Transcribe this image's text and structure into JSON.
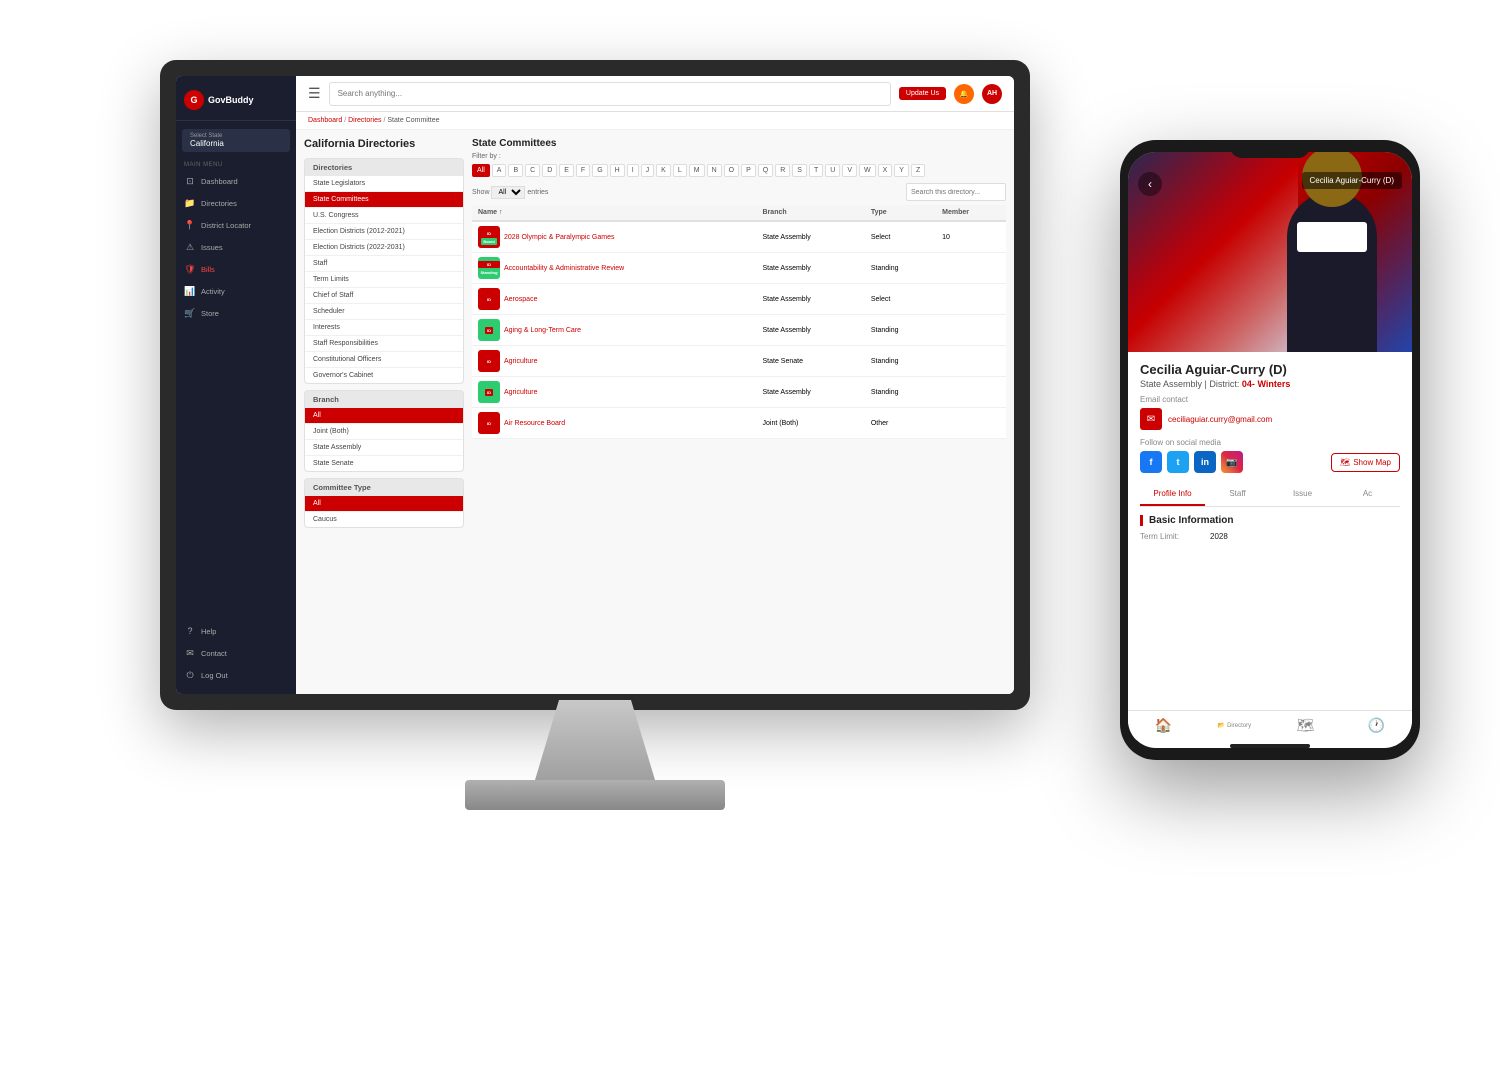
{
  "page": {
    "background": "#f0f0f0"
  },
  "app": {
    "name": "GovBuddy",
    "logo_letter": "G"
  },
  "header": {
    "search_placeholder": "Search anything...",
    "update_btn": "Update Us",
    "menu_icon": "☰"
  },
  "breadcrumb": {
    "items": [
      "Dashboard",
      "Directories",
      "State Committee"
    ]
  },
  "sidebar": {
    "state_select": "Select State",
    "state_name": "California",
    "section_label": "Main Menu",
    "items": [
      {
        "label": "Dashboard",
        "icon": "⊡"
      },
      {
        "label": "Directories",
        "icon": "📁"
      },
      {
        "label": "District Locator",
        "icon": "📍"
      },
      {
        "label": "Issues",
        "icon": "⚠"
      },
      {
        "label": "Bills",
        "icon": "🛡"
      },
      {
        "label": "Activity",
        "icon": "📊"
      },
      {
        "label": "Store",
        "icon": "🛒"
      },
      {
        "label": "Help",
        "icon": "?"
      },
      {
        "label": "Contact",
        "icon": "✉"
      },
      {
        "label": "Log Out",
        "icon": "⏻"
      }
    ]
  },
  "left_panel": {
    "page_title": "California Directories",
    "directories_section": {
      "title": "Directories",
      "items": [
        "State Legislators",
        "State Committees",
        "U.S. Congress",
        "Election Districts (2012-2021)",
        "Election Districts (2022-2031)",
        "Staff",
        "Term Limits",
        "Chief of Staff",
        "Scheduler",
        "Interests",
        "Staff Responsibilities",
        "Constitutional Officers",
        "Governor's Cabinet"
      ],
      "active_item": "State Committees"
    },
    "branch_section": {
      "title": "Branch",
      "items": [
        "All",
        "Joint (Both)",
        "State Assembly",
        "State Senate"
      ],
      "active_item": "All"
    },
    "committee_type_section": {
      "title": "Committee Type",
      "items": [
        "All",
        "Caucus"
      ],
      "active_item": "All"
    }
  },
  "right_panel": {
    "title": "State Committees",
    "filter_label": "Filter by :",
    "alpha_letters": [
      "All",
      "A",
      "B",
      "C",
      "D",
      "E",
      "F",
      "G",
      "H",
      "I",
      "J",
      "K",
      "L",
      "M",
      "N",
      "O",
      "P",
      "Q",
      "R",
      "S",
      "T",
      "U",
      "V",
      "W",
      "X",
      "Y",
      "Z"
    ],
    "active_alpha": "All",
    "show_label": "Show",
    "entries_label": "entries",
    "search_placeholder": "Search this directory...",
    "table_headers": [
      "Name",
      "Branch",
      "Type",
      "Member"
    ],
    "rows": [
      {
        "name": "2028 Olympic & Paralympic Games",
        "branch": "State Assembly",
        "type": "Select",
        "member": "10",
        "tag1": "ID",
        "tag2": "Board"
      },
      {
        "name": "Accountability & Administrative Review",
        "branch": "State Assembly",
        "type": "Standing",
        "tag1": "ID",
        "tag2": "Standing"
      },
      {
        "name": "Aerospace",
        "branch": "State Assembly",
        "type": "Select",
        "tag1": "ID"
      },
      {
        "name": "Aging & Long-Term Care",
        "branch": "State Assembly",
        "type": "Standing",
        "tag1": "ID"
      },
      {
        "name": "Agriculture",
        "branch": "State Senate",
        "type": "Standing",
        "tag1": "ID"
      },
      {
        "name": "Agriculture",
        "branch": "State Assembly",
        "type": "Standing",
        "tag1": "ID"
      },
      {
        "name": "Air Resource Board",
        "branch": "Joint (Both)",
        "type": "Other",
        "tag1": "ID"
      }
    ]
  },
  "phone": {
    "person_name": "Cecilia Aguiar-Curry (D)",
    "title": "State Assembly",
    "district_label": "District:",
    "district_number": "04-",
    "district_city": "Winters",
    "email_section_label": "Email contact",
    "email": "ceciliaguiar.curry@gmail.com",
    "social_label": "Follow on social media",
    "social_icons": [
      "f",
      "t",
      "in",
      "📷"
    ],
    "show_map_btn": "Show Map",
    "tabs": [
      "Profile Info",
      "Staff",
      "Issue",
      "Ac"
    ],
    "active_tab": "Profile Info",
    "basic_info_title": "Basic Information",
    "term_limit_label": "Term Limit:",
    "term_limit_value": "2028",
    "nav_items": [
      "🏠",
      "Directory",
      "🗺",
      "🕐"
    ],
    "active_nav": "Directory",
    "back_icon": "‹",
    "header_name": "Cecilia Aguiar-Curry (D)"
  }
}
